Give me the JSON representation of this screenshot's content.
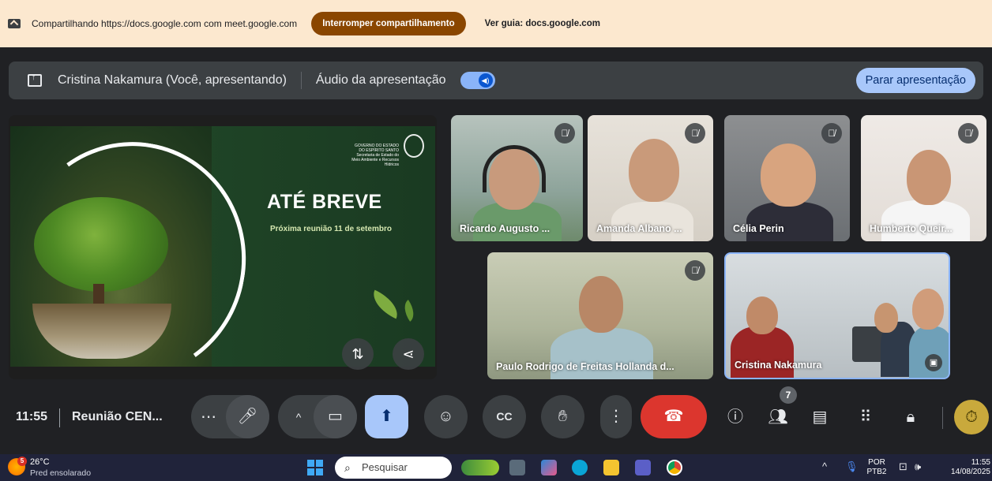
{
  "sharebar": {
    "message": "Compartilhando https://docs.google.com com meet.google.com",
    "stop_button": "Interromper compartilhamento",
    "view_tab": "Ver guia: docs.google.com"
  },
  "presentation_bar": {
    "presenter": "Cristina Nakamura (Você, apresentando)",
    "audio_label": "Áudio da apresentação",
    "stop_button": "Parar apresentação"
  },
  "slide": {
    "title": "ATÉ BREVE",
    "subtitle": "Próxima reunião 11 de setembro",
    "logo_line1": "GOVERNO DO ESTADO",
    "logo_line2": "DO ESPÍRITO SANTO",
    "logo_line3": "Secretaria de Estado do",
    "logo_line4": "Meio Ambiente e Recursos Hídricos"
  },
  "participants": [
    {
      "name": "Ricardo Augusto ...",
      "muted": true
    },
    {
      "name": "Amanda Albano ...",
      "muted": true
    },
    {
      "name": "Célia Perin",
      "muted": true
    },
    {
      "name": "Humberto Queir...",
      "muted": true
    },
    {
      "name": "Paulo Rodrigo de Freitas Hollanda d...",
      "muted": true
    },
    {
      "name": "Cristina Nakamura",
      "muted": false
    }
  ],
  "toolbar": {
    "time": "11:55",
    "meeting_name": "Reunião CEN...",
    "participants_count": "7"
  },
  "taskbar": {
    "weather_badge": "5",
    "temperature": "26°C",
    "weather_desc": "Pred ensolarado",
    "search_placeholder": "Pesquisar",
    "lang_top": "POR",
    "lang_bottom": "PTB2",
    "time": "11:55",
    "date": "14/08/2025"
  },
  "colors": {
    "share_bg": "#fce8cf",
    "stop_share": "#8a4600",
    "meet_bg": "#202124",
    "accent": "#a8c7fa",
    "end_call": "#dc362e"
  }
}
